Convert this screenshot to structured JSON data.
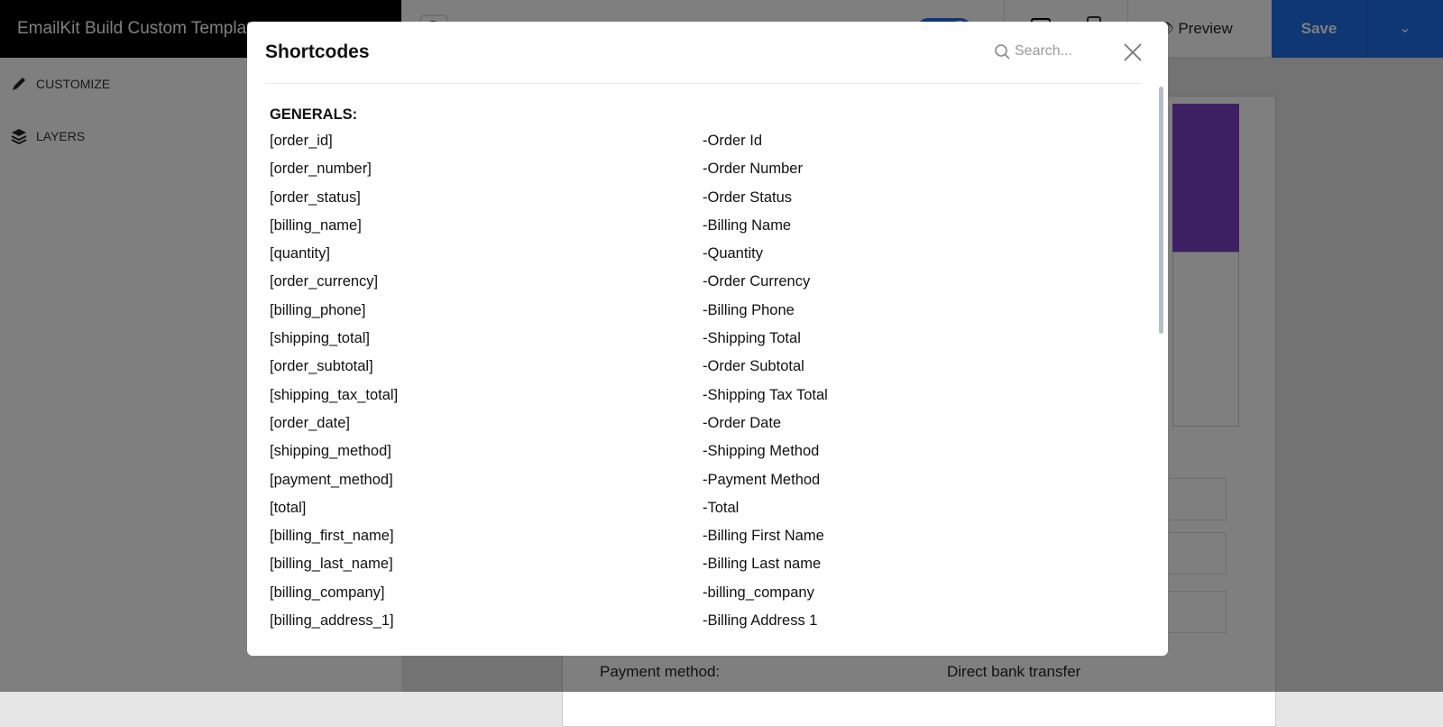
{
  "header": {
    "title": "EmailKit Build Custom Template",
    "preview_label": "Preview",
    "save_label": "Save"
  },
  "sidebar": {
    "items": [
      {
        "label": "CUSTOMIZE",
        "icon": "pencil-icon"
      },
      {
        "label": "LAYERS",
        "icon": "layers-icon"
      }
    ]
  },
  "preview_content": {
    "payment_label": "Payment method:",
    "payment_value": "Direct bank transfer"
  },
  "modal": {
    "title": "Shortcodes",
    "search_placeholder": "Search...",
    "section": "GENERALS:",
    "rows": [
      {
        "code": "[order_id]",
        "desc": "-Order Id"
      },
      {
        "code": "[order_number]",
        "desc": "-Order Number"
      },
      {
        "code": "[order_status]",
        "desc": "-Order Status"
      },
      {
        "code": "[billing_name]",
        "desc": "-Billing Name"
      },
      {
        "code": "[quantity]",
        "desc": "-Quantity"
      },
      {
        "code": "[order_currency]",
        "desc": "-Order Currency"
      },
      {
        "code": "[billing_phone]",
        "desc": "-Billing Phone"
      },
      {
        "code": "[shipping_total]",
        "desc": "-Shipping Total"
      },
      {
        "code": "[order_subtotal]",
        "desc": "-Order Subtotal"
      },
      {
        "code": "[shipping_tax_total]",
        "desc": "-Shipping Tax Total"
      },
      {
        "code": "[order_date]",
        "desc": "-Order Date"
      },
      {
        "code": "[shipping_method]",
        "desc": "-Shipping Method"
      },
      {
        "code": "[payment_method]",
        "desc": "-Payment Method"
      },
      {
        "code": "[total]",
        "desc": "-Total"
      },
      {
        "code": "[billing_first_name]",
        "desc": "-Billing First Name"
      },
      {
        "code": "[billing_last_name]",
        "desc": "-Billing Last name"
      },
      {
        "code": "[billing_company]",
        "desc": "-billing_company"
      },
      {
        "code": "[billing_address_1]",
        "desc": "-Billing Address 1"
      }
    ]
  },
  "colors": {
    "accent": "#1e6fe6",
    "banner": "#7b40c8"
  }
}
